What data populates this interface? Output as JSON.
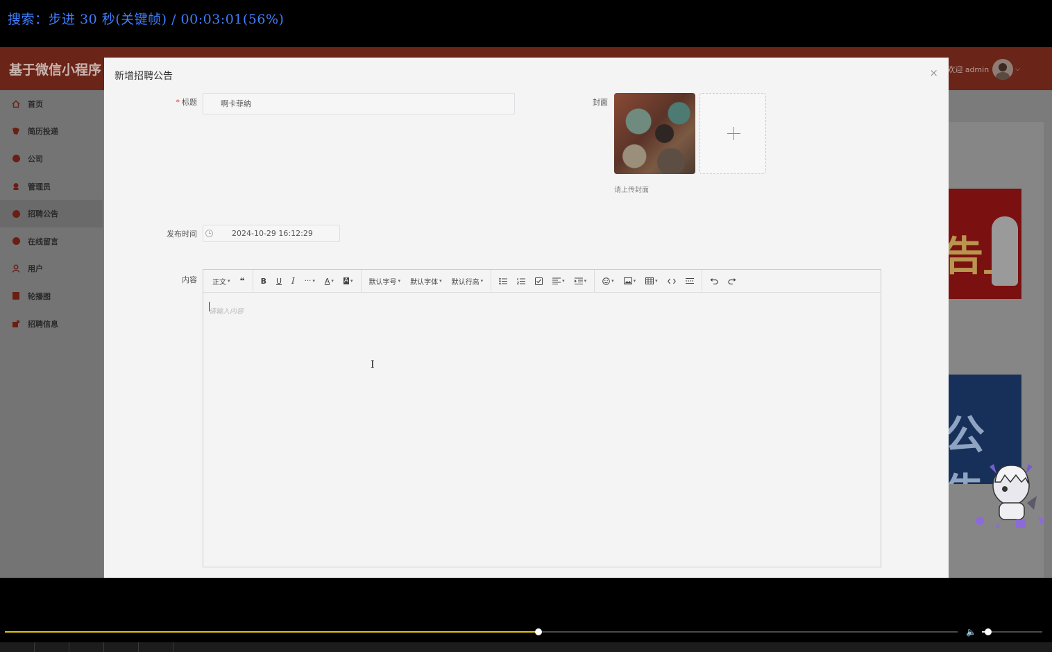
{
  "osd": {
    "text": "搜索：步进 30 秒(关键帧) / 00:03:01(56%)"
  },
  "app": {
    "title": "基于微信小程序",
    "user": {
      "greeting": "欢迎 admin"
    }
  },
  "sidebar": {
    "items": [
      {
        "label": "首页",
        "icon": "home-icon"
      },
      {
        "label": "简历投递",
        "icon": "resume-icon"
      },
      {
        "label": "公司",
        "icon": "company-icon"
      },
      {
        "label": "管理员",
        "icon": "admin-icon"
      },
      {
        "label": "招聘公告",
        "icon": "notice-icon",
        "active": true
      },
      {
        "label": "在线留言",
        "icon": "message-icon"
      },
      {
        "label": "用户",
        "icon": "user-icon"
      },
      {
        "label": "轮播图",
        "icon": "carousel-icon"
      },
      {
        "label": "招聘信息",
        "icon": "job-info-icon"
      }
    ]
  },
  "background": {
    "banner1_text": "告」",
    "banner2_text": "公告"
  },
  "modal": {
    "title": "新增招聘公告",
    "close": "×",
    "form": {
      "title_label": "标题",
      "title_value": "啊卡菲纳",
      "cover_label": "封面",
      "cover_hint": "请上传封面",
      "publish_label": "发布时间",
      "publish_value": "2024-10-29 16:12:29",
      "content_label": "内容",
      "content_placeholder": "请输入内容"
    },
    "toolbar": {
      "paragraph": "正文",
      "quote": "❝",
      "bold": "B",
      "underline": "U",
      "italic": "I",
      "more": "···",
      "font_color": "A",
      "bg_color": "A",
      "font_size": "默认字号",
      "font_family": "默认字体",
      "line_height": "默认行高"
    }
  },
  "player": {
    "progress": 0.56,
    "volume": 0.1
  }
}
